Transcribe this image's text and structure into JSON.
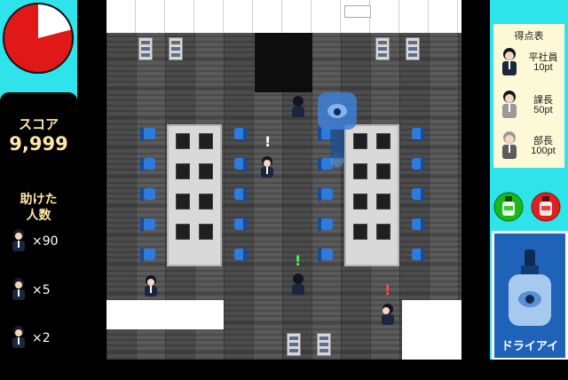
{
  "timer": {
    "remaining_fraction": 0.21,
    "fill_color": "#e01818",
    "empty_color": "#ffffff"
  },
  "score": {
    "label": "スコア",
    "value": "9,999"
  },
  "saved": {
    "label_line1": "助けた",
    "label_line2": "人数",
    "counts": [
      {
        "icon": "staff-icon",
        "value": "×90"
      },
      {
        "icon": "section-chief-icon",
        "value": "×5"
      },
      {
        "icon": "department-head-icon",
        "value": "×2"
      }
    ]
  },
  "points_table": {
    "title": "得点表",
    "rows": [
      {
        "icon": "staff-icon",
        "role": "平社員",
        "points": "10pt"
      },
      {
        "icon": "section-chief-icon",
        "role": "課長",
        "points": "50pt"
      },
      {
        "icon": "department-head-icon",
        "role": "部長",
        "points": "100pt"
      }
    ]
  },
  "items": {
    "green_drop_label": "eye-drop-green",
    "red_drop_label": "eye-drop-red",
    "selected_name": "ドライアイ"
  },
  "map": {
    "alerts": [
      {
        "color": "#ffffff",
        "symbol": "!"
      },
      {
        "color": "#55ee55",
        "symbol": "!"
      },
      {
        "color": "#ff4d4d",
        "symbol": "!"
      }
    ]
  }
}
